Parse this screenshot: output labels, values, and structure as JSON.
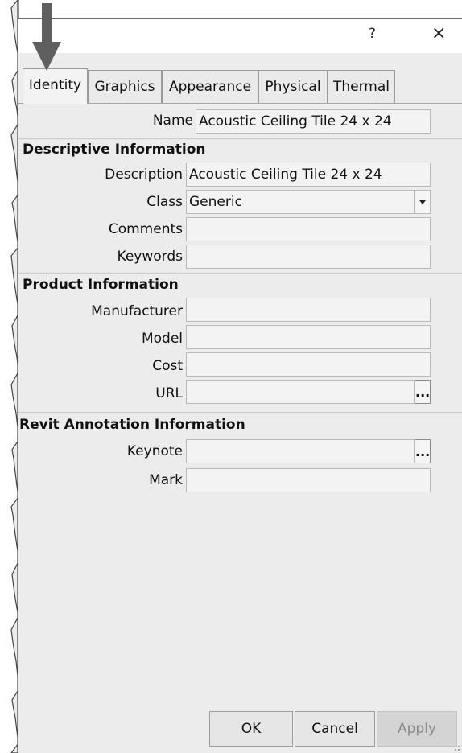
{
  "dialog": {
    "help_glyph": "?",
    "close_glyph": "×"
  },
  "tabs": [
    {
      "label": "Identity",
      "active": true
    },
    {
      "label": "Graphics",
      "active": false
    },
    {
      "label": "Appearance",
      "active": false
    },
    {
      "label": "Physical",
      "active": false
    },
    {
      "label": "Thermal",
      "active": false
    }
  ],
  "name": {
    "label": "Name",
    "value": "Acoustic Ceiling Tile 24 x 24"
  },
  "descriptive": {
    "title": "Descriptive Information",
    "description": {
      "label": "Description",
      "value": "Acoustic Ceiling Tile 24 x 24"
    },
    "class": {
      "label": "Class",
      "value": "Generic"
    },
    "comments": {
      "label": "Comments",
      "value": ""
    },
    "keywords": {
      "label": "Keywords",
      "value": ""
    }
  },
  "product": {
    "title": "Product Information",
    "manufacturer": {
      "label": "Manufacturer",
      "value": ""
    },
    "model": {
      "label": "Model",
      "value": ""
    },
    "cost": {
      "label": "Cost",
      "value": ""
    },
    "url": {
      "label": "URL",
      "value": "",
      "browse": "..."
    }
  },
  "annotation": {
    "title": "Revit Annotation Information",
    "keynote": {
      "label": "Keynote",
      "value": "",
      "browse": "..."
    },
    "mark": {
      "label": "Mark",
      "value": ""
    }
  },
  "buttons": {
    "ok": "OK",
    "cancel": "Cancel",
    "apply": "Apply"
  },
  "colors": {
    "dialog_bg": "#ececec",
    "field_bg": "#f3f3f3",
    "arrow": "#5f5f5f"
  }
}
